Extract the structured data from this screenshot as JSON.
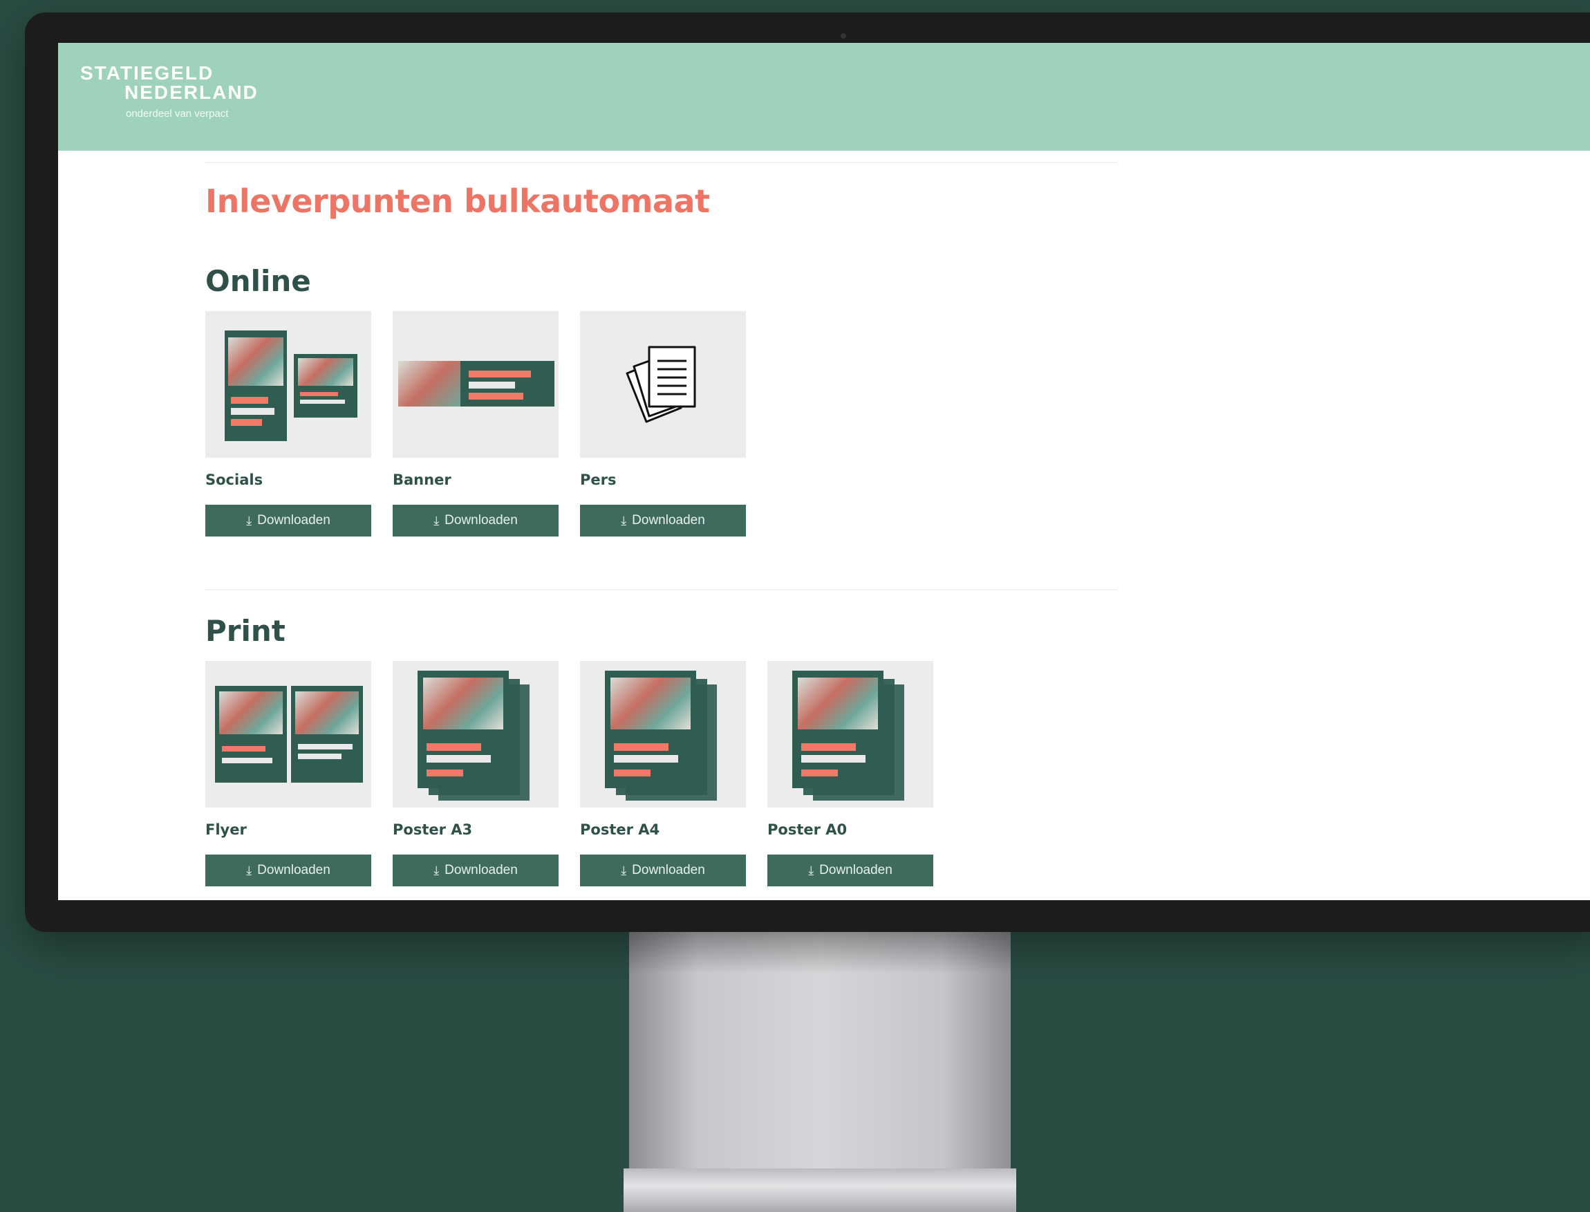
{
  "header": {
    "logo_line1": "STATIEGELD",
    "logo_line2": "NEDERLAND",
    "logo_tagline": "onderdeel van verpact"
  },
  "page": {
    "title": "Inleverpunten bulkautomaat"
  },
  "sections": {
    "online": {
      "title": "Online",
      "items": [
        {
          "label": "Socials",
          "button": "Downloaden"
        },
        {
          "label": "Banner",
          "button": "Downloaden"
        },
        {
          "label": "Pers",
          "button": "Downloaden"
        }
      ]
    },
    "print": {
      "title": "Print",
      "items": [
        {
          "label": "Flyer",
          "button": "Downloaden"
        },
        {
          "label": "Poster A3",
          "button": "Downloaden"
        },
        {
          "label": "Poster A4",
          "button": "Downloaden"
        },
        {
          "label": "Poster A0",
          "button": "Downloaden"
        }
      ]
    }
  },
  "icons": {
    "download": "download-icon",
    "documents": "documents-icon"
  },
  "colors": {
    "background": "#2a4c43",
    "header": "#9ed2bb",
    "title": "#ec7565",
    "heading": "#2f5149",
    "button": "#3f6a5e"
  }
}
